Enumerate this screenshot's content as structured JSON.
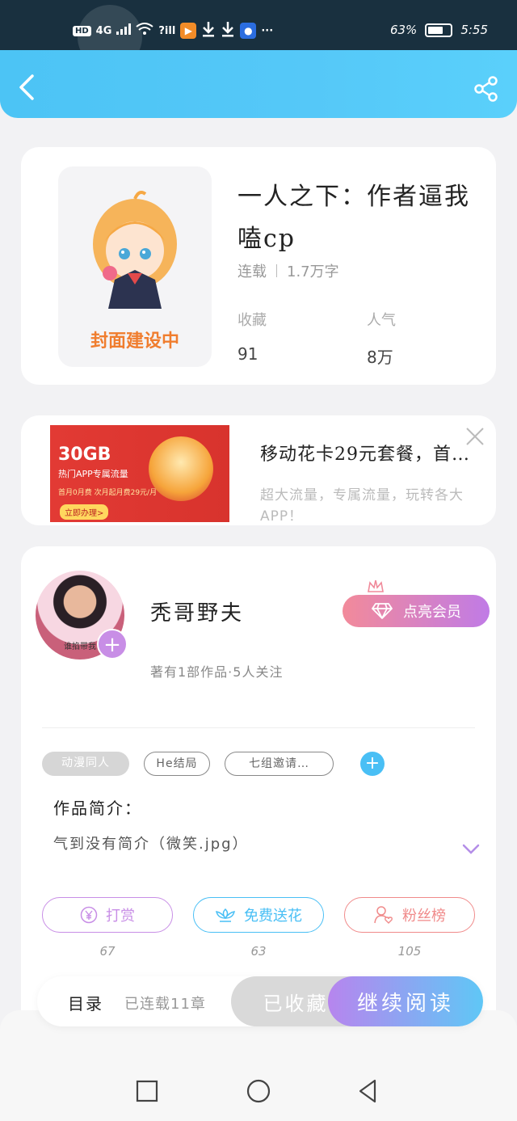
{
  "status_bar": {
    "hd": "HD",
    "network": "4G",
    "wifi_label": "?ill",
    "app_icon_1": "orange-app-icon",
    "app_icon_2": "blue-app-icon",
    "more": "···",
    "battery_pct": "63%",
    "time": "5:55"
  },
  "header": {
    "back_icon": "chevron-left-icon",
    "share_icon": "share-icon"
  },
  "book": {
    "cover_text": "封面建设中",
    "title": "一人之下：作者逼我嗑cp",
    "status": "连载",
    "word_count": "1.7万字",
    "stats": [
      {
        "label": "收藏",
        "value": "91"
      },
      {
        "label": "人气",
        "value": "8万"
      }
    ]
  },
  "ad": {
    "image_title": "30GB",
    "image_sub": "热门APP专属流量",
    "image_price": "首月0月费 次月起月费29元/月",
    "image_button": "立即办理>",
    "title": "移动花卡29元套餐，首…",
    "desc": "超大流量，专属流量，玩转各大APP！"
  },
  "author": {
    "avatar_caption": "谁掐带我",
    "name": "秃哥野夫",
    "summary": "著有1部作品·5人关注",
    "vip_label": "点亮会员"
  },
  "tags": [
    {
      "label": "动漫同人",
      "style": "fill"
    },
    {
      "label": "He结局",
      "style": "outline"
    },
    {
      "label": "七组邀请…",
      "style": "outline"
    }
  ],
  "intro": {
    "label": "作品简介：",
    "text": "气到没有简介（微笑.jpg）"
  },
  "actions": [
    {
      "label": "打赏",
      "icon": "yen-icon",
      "count": "67",
      "color": "#c88ee6"
    },
    {
      "label": "免费送花",
      "icon": "flower-icon",
      "count": "63",
      "color": "#49bff5"
    },
    {
      "label": "粉丝榜",
      "icon": "user-heart-icon",
      "count": "105",
      "color": "#f08a8a"
    }
  ],
  "bottom_bar": {
    "toc": "目录",
    "chapters": "已连载11章",
    "collected": "已收藏",
    "read": "继续阅读"
  },
  "nav": {
    "recent": "square-icon",
    "home": "circle-icon",
    "back": "triangle-back-icon"
  }
}
